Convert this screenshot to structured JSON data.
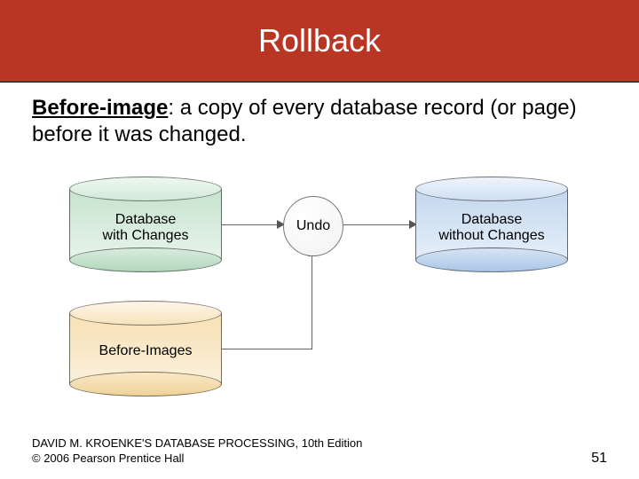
{
  "title": "Rollback",
  "definition": {
    "term": "Before-image",
    "rest": ": a copy of every database record (or page) before it was changed."
  },
  "diagram": {
    "db_with_changes": {
      "line1": "Database",
      "line2": "with Changes"
    },
    "before_images": {
      "line1": "Before-Images"
    },
    "undo": "Undo",
    "db_without_changes": {
      "line1": "Database",
      "line2": "without Changes"
    }
  },
  "footer": {
    "line1": "DAVID M. KROENKE'S DATABASE PROCESSING, 10th Edition",
    "line2": "© 2006 Pearson Prentice Hall",
    "page": "51"
  }
}
